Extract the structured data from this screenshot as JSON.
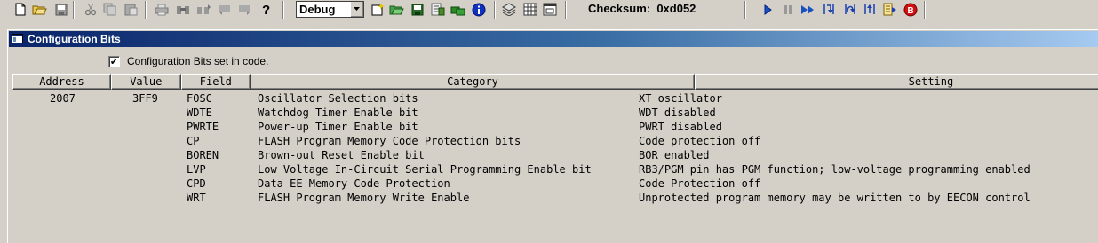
{
  "toolbar": {
    "config_select_value": "Debug",
    "checksum_label": "Checksum:",
    "checksum_value": "0xd052",
    "icons": [
      "new-file-icon",
      "open-folder-icon",
      "save-icon",
      "cut-icon",
      "copy-icon",
      "paste-icon",
      "print-icon",
      "find-icon",
      "find-next-icon",
      "undo-icon",
      "redo-icon",
      "help-icon",
      "new-project-icon",
      "open-project-icon",
      "save-project-icon",
      "build-icon",
      "make-icon",
      "info-icon",
      "stack-icon",
      "grid-icon",
      "window-icon",
      "run-icon",
      "pause-icon",
      "animate-icon",
      "step-into-icon",
      "step-over-icon",
      "step-out-icon",
      "reset-icon",
      "breakpoint-icon"
    ]
  },
  "window": {
    "title": "Configuration Bits",
    "checkbox_label": "Configuration Bits set in code.",
    "checkbox_checked": true,
    "checkbox_glyph": "✔",
    "columns": [
      "Address",
      "Value",
      "Field",
      "Category",
      "Setting"
    ],
    "rows": [
      {
        "address": "2007",
        "value": "3FF9",
        "field": "FOSC",
        "category": "Oscillator Selection bits",
        "setting": "XT oscillator"
      },
      {
        "address": "",
        "value": "",
        "field": "WDTE",
        "category": "Watchdog Timer Enable bit",
        "setting": "WDT disabled"
      },
      {
        "address": "",
        "value": "",
        "field": "PWRTE",
        "category": "Power-up Timer Enable bit",
        "setting": "PWRT disabled"
      },
      {
        "address": "",
        "value": "",
        "field": "CP",
        "category": "FLASH Program Memory Code Protection bits",
        "setting": "Code protection off"
      },
      {
        "address": "",
        "value": "",
        "field": "BOREN",
        "category": "Brown-out Reset Enable bit",
        "setting": "BOR enabled"
      },
      {
        "address": "",
        "value": "",
        "field": "LVP",
        "category": "Low Voltage In-Circuit Serial Programming Enable bit",
        "setting": "RB3/PGM pin has PGM function; low-voltage programming enabled"
      },
      {
        "address": "",
        "value": "",
        "field": "CPD",
        "category": "Data EE Memory Code Protection",
        "setting": "Code Protection off"
      },
      {
        "address": "",
        "value": "",
        "field": "WRT",
        "category": "FLASH Program Memory Write Enable",
        "setting": "Unprotected program memory may be written to by EECON control"
      }
    ]
  }
}
